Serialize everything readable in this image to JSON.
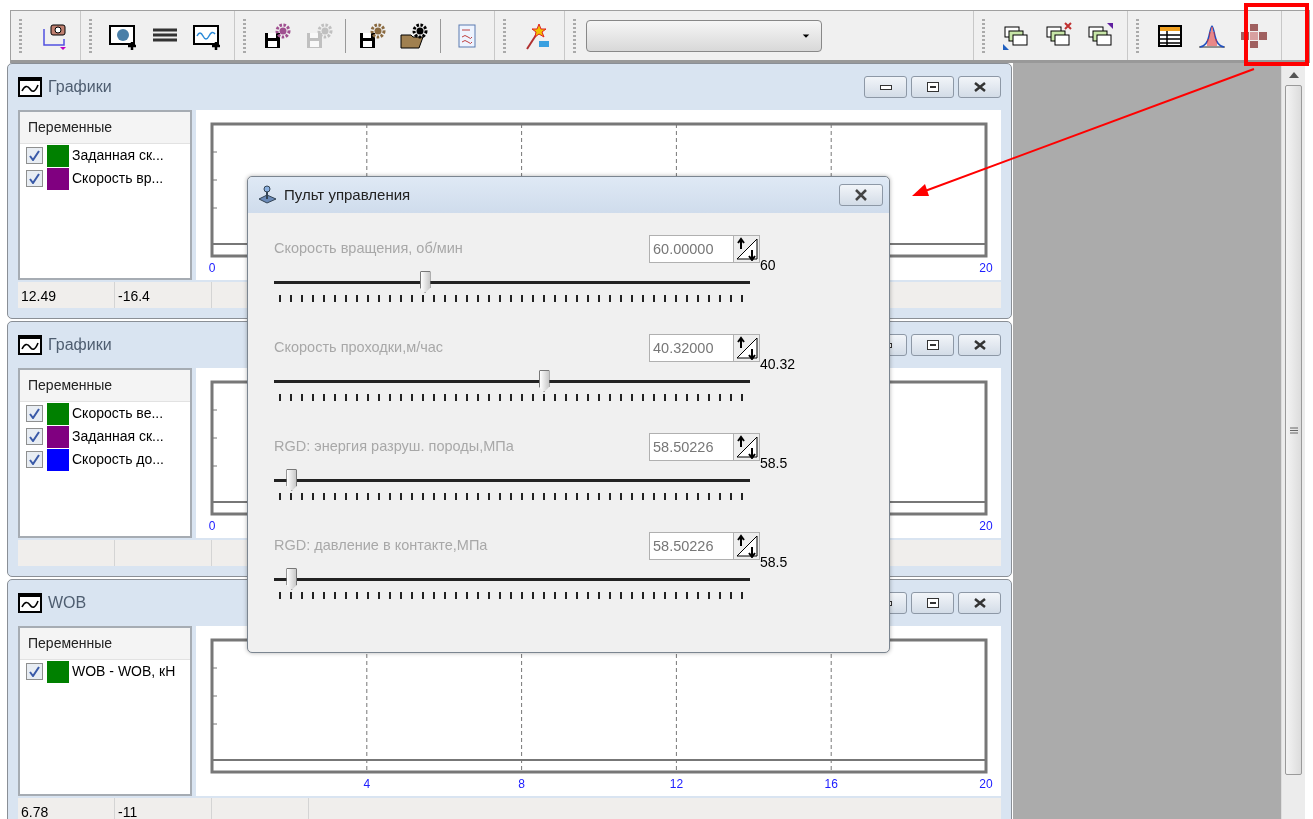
{
  "toolbar": {
    "groups": [
      {
        "items": [
          {
            "kind": "camera",
            "disabled": false
          }
        ]
      },
      {
        "items": [
          {
            "kind": "image-add",
            "disabled": false
          },
          {
            "kind": "list",
            "disabled": false
          },
          {
            "kind": "chart-add",
            "disabled": false
          }
        ]
      },
      {
        "items": [
          {
            "kind": "save-gear",
            "disabled": false
          },
          {
            "kind": "save-gear",
            "disabled": true
          },
          {
            "kind": "separator"
          },
          {
            "kind": "floppy-gear",
            "disabled": false
          },
          {
            "kind": "folder-gear",
            "disabled": false
          },
          {
            "kind": "separator"
          },
          {
            "kind": "report",
            "disabled": false
          }
        ]
      },
      {
        "items": [
          {
            "kind": "wand",
            "disabled": false
          }
        ]
      },
      {
        "items": [
          {
            "kind": "combo"
          }
        ]
      },
      {
        "items": [
          {
            "kind": "stack-corner",
            "disabled": false
          },
          {
            "kind": "stack-x",
            "disabled": false
          },
          {
            "kind": "stack-mark",
            "disabled": false
          }
        ]
      },
      {
        "items": [
          {
            "kind": "table",
            "disabled": false
          },
          {
            "kind": "bell",
            "disabled": false
          },
          {
            "kind": "pad",
            "disabled": false
          }
        ]
      }
    ]
  },
  "windows": [
    {
      "title": "Графики",
      "legend_header": "Переменные",
      "variables": [
        {
          "label": "Заданная ск...",
          "checked": true,
          "color": "#008000"
        },
        {
          "label": "Скорость вр...",
          "checked": true,
          "color": "#800080"
        }
      ],
      "status": [
        "12.49",
        "-16.4"
      ],
      "axis_labels": [
        {
          "text": "0",
          "kind": "start"
        },
        {
          "text": "20",
          "kind": "end"
        }
      ]
    },
    {
      "title": "Графики",
      "legend_header": "Переменные",
      "variables": [
        {
          "label": "Скорость ве...",
          "checked": true,
          "color": "#008000"
        },
        {
          "label": "Заданная ск...",
          "checked": true,
          "color": "#800080"
        },
        {
          "label": "Скорость до...",
          "checked": true,
          "color": "#0000ff"
        }
      ],
      "axis_labels": [
        {
          "text": "0",
          "kind": "start"
        },
        {
          "text": "20",
          "kind": "end"
        }
      ]
    },
    {
      "title": "WOB",
      "legend_header": "Переменные",
      "variables": [
        {
          "label": "WOB - WOB, кН",
          "checked": true,
          "color": "#008000"
        }
      ],
      "status": [
        "6.78",
        "-11"
      ],
      "axis_labels": [
        {
          "text": "4",
          "kind": "grid"
        },
        {
          "text": "8",
          "kind": "grid"
        },
        {
          "text": "12",
          "kind": "grid"
        },
        {
          "text": "16",
          "kind": "grid"
        },
        {
          "text": "20",
          "kind": "end"
        }
      ]
    }
  ],
  "dialog": {
    "title": "Пульт управления",
    "controls": [
      {
        "label": "Скорость вращения, об/мин",
        "value": "60.00000",
        "reading": "60",
        "level": 0.31
      },
      {
        "label": "Скорость проходки,м/час",
        "value": "40.32000",
        "reading": "40.32",
        "level": 0.56
      },
      {
        "label": "RGD: энергия разруш. породы,МПа",
        "value": "58.50226",
        "reading": "58.5",
        "level": 0.03
      },
      {
        "label": "RGD: давление в контакте,МПа",
        "value": "58.50226",
        "reading": "58.5",
        "level": 0.03
      }
    ]
  }
}
